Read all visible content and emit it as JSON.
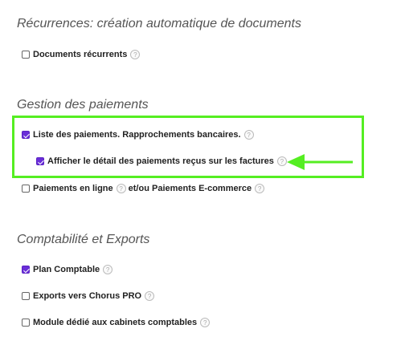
{
  "sections": {
    "recurrences": {
      "title": "Récurrences: création automatique de documents",
      "items": [
        {
          "label": "Documents récurrents",
          "checked": false
        }
      ]
    },
    "payments": {
      "title": "Gestion des paiements",
      "items": [
        {
          "label": "Liste des paiements. Rapprochements bancaires.",
          "checked": true
        },
        {
          "label": "Afficher le détail des paiements reçus sur les factures",
          "checked": true
        },
        {
          "label": "Paiements en ligne",
          "label_suffix": "et/ou Paiements E-commerce",
          "checked": false
        }
      ]
    },
    "accounting": {
      "title": "Comptabilité et Exports",
      "items": [
        {
          "label": "Plan Comptable",
          "checked": true
        },
        {
          "label": "Exports vers Chorus PRO",
          "checked": false
        },
        {
          "label": "Module dédié aux cabinets comptables",
          "checked": false
        }
      ]
    }
  },
  "help_glyph": "?",
  "colors": {
    "highlight": "#55ee22",
    "checkbox_checked": "#6a2ed8"
  },
  "icons": {
    "help": "question-circle-icon",
    "annotation": "arrow-left-icon"
  }
}
